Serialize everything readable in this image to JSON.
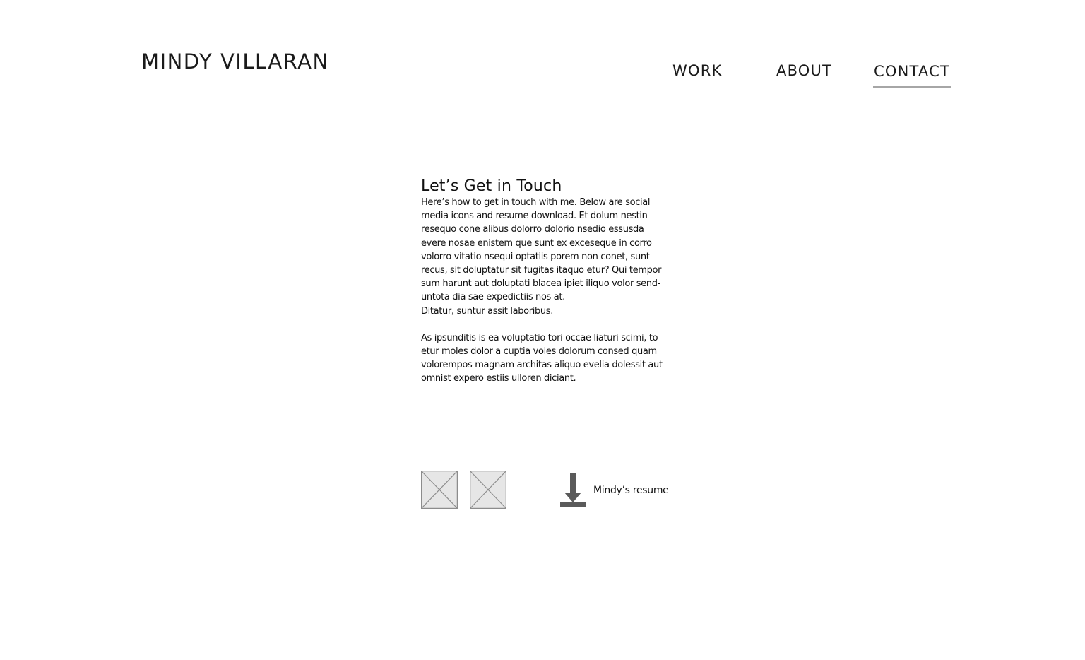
{
  "header": {
    "logo_text": "MINDY VILLARAN"
  },
  "nav": {
    "items": [
      {
        "label": "WORK"
      },
      {
        "label": "ABOUT"
      },
      {
        "label": "CONTACT",
        "active": true
      }
    ],
    "active_underline_color": "#a6a6a6"
  },
  "main": {
    "heading": "Let’s Get in Touch",
    "paragraph_1_lines": [
      "Here’s how to get in touch with me. Below are social",
      "media icons and resume download. Et dolum nestin",
      "resequo cone alibus dolorro dolorio nsedio essusda",
      "evere nosae enistem que sunt ex exceseque in corro",
      "volorro vitatio nsequi optatiis porem non conet, sunt",
      "recus, sit doluptatur sit fugitas itaquo etur? Qui tempor",
      "sum harunt aut doluptati blacea ipiet iliquo volor send-",
      "untota dia sae expedictiis nos at.",
      "Ditatur, suntur assit laboribus."
    ],
    "paragraph_2_lines": [
      "As ipsunditis is ea voluptatio tori occae liaturi scimi, to",
      "etur moles dolor a cuptia voles dolorum consed quam",
      "volorempos magnam architas aliquo evelia dolessit aut",
      "omnist expero estiis ulloren diciant."
    ]
  },
  "social": {
    "icons": [
      {
        "name": "image-placeholder-icon"
      },
      {
        "name": "image-placeholder-icon"
      }
    ],
    "placeholder_fill": "#e6e6e6",
    "placeholder_stroke": "#8c8c8c"
  },
  "resume": {
    "icon": "download-icon",
    "icon_color": "#5a5a5a",
    "label": "Mindy’s resume"
  }
}
